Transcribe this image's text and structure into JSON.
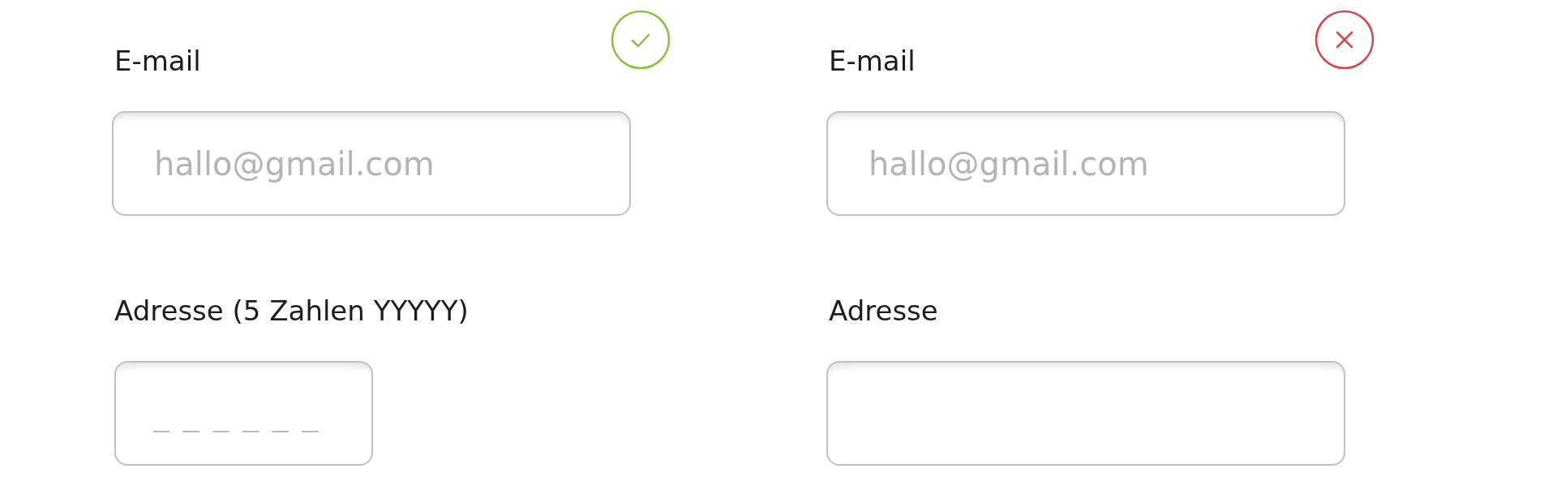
{
  "forms": [
    {
      "valid": true,
      "fields": [
        {
          "label": "E-mail",
          "placeholder": "hallo@gmail.com",
          "kind": "wide"
        },
        {
          "label": "Adresse (5 Zahlen YYYYY)",
          "placeholder": "_ _ _ _ _ _",
          "kind": "short"
        }
      ]
    },
    {
      "valid": false,
      "fields": [
        {
          "label": "E-mail",
          "placeholder": "hallo@gmail.com",
          "kind": "wide"
        },
        {
          "label": "Adresse",
          "kind": "wide"
        }
      ]
    }
  ]
}
